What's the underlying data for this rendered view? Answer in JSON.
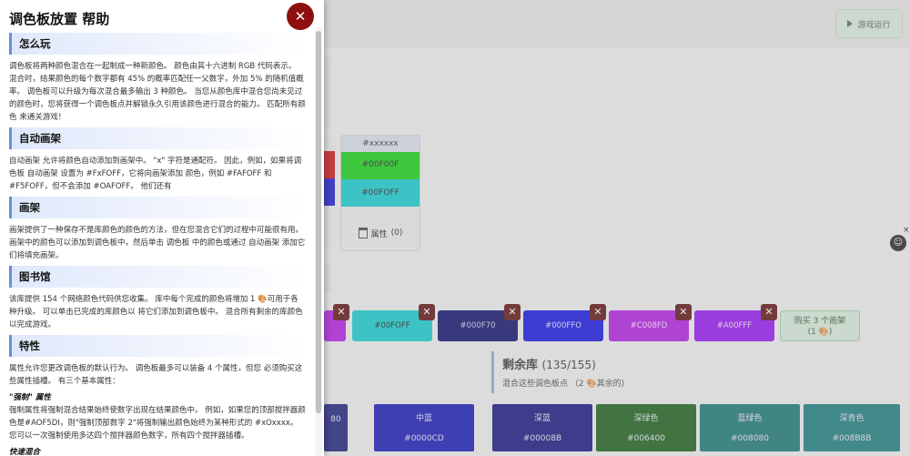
{
  "help": {
    "title": "调色板放置 帮助",
    "close_label": "✕",
    "sections": [
      {
        "heading": "怎么玩",
        "text": "调色板将两种颜色混合在一起制成一种新颜色。 颜色由其十六进制 RGB 代码表示。 混合时，结果颜色的每个数字都有 45% 的概率匹配任一父数字，外加 5% 的随机值概率。 调色板可以升级为每次混合最多输出 3 种颜色。 当您从颜色库中混合您尚未见过的颜色时，您将获得一个调色板点并解锁永久引用该颜色进行混合的能力。 匹配所有颜色 来通关游戏！"
      },
      {
        "heading": "自动画架",
        "text": "自动画架 允许将颜色自动添加到画架中。 \"x\" 字符是通配符。 因此，例如，如果将调色板 自动画架 设置为 #FxFOFF，它将向画架添加 颜色，例如 #FAFOFF 和 #F5FOFF，但不会添加 #OAFOFF。 他们还有"
      },
      {
        "heading": "画架",
        "text": "画架提供了一种保存不是库颜色的颜色的方法，但在您混合它们的过程中可能很有用。 画架中的颜色可以添加到调色板中，然后单击 调色板 中的颜色或通过 自动画架 添加它们将填充画架。"
      },
      {
        "heading": "图书馆",
        "text": "该库提供 154 个网络颜色代码供您收集。 库中每个完成的颜色将增加 1 🎨可用于各种升级。 可以单击已完成的库颜色以 将它们添加到调色板中。 混合所有剩余的库颜色以完成游戏。"
      },
      {
        "heading": "特性",
        "text": "属性允许您更改调色板的默认行为。 调色板最多可以装备 4 个属性，但您 必须购买这些属性插槽。 有三个基本属性："
      }
    ],
    "sub_heading": "\"强制\" 属性",
    "sub_text": "强制属性将强制混合结果始终使数字出现在结果颜色中。 例如，如果您的顶部搅拌器颜色是#AOF5DI，则\"强制顶部数字 2\"将强制输出颜色始终为某种形式的 #xOxxxx。 您可以一次强制使用多达四个搅拌器颜色数字，所有四个搅拌器插槽。",
    "next_heading": "快速混合"
  },
  "game": {
    "run_button": "游戏运行",
    "easel": {
      "code": "#xxxxxx",
      "color1": "#00F00F",
      "color2": "#00FOFF",
      "props_label": "属性",
      "props_count": "(0)"
    },
    "palette": [
      {
        "code": "#00FOFF",
        "bg": "#10c8cc",
        "fg": "#222222"
      },
      {
        "code": "#000F70",
        "bg": "#0a0a6a",
        "fg": "#c8c8e8"
      },
      {
        "code": "#000FFO",
        "bg": "#1010e0",
        "fg": "#d8d8f8"
      },
      {
        "code": "#C008FD",
        "bg": "#b018e0",
        "fg": "#f0d8f8"
      },
      {
        "code": "#A00FFF",
        "bg": "#9010f0",
        "fg": "#f0d8f8"
      }
    ],
    "buy_button": {
      "line1": "购买 3 个画架",
      "line2": "(1 🎨)"
    },
    "library": {
      "title": "剩余库",
      "count": "(135/155)",
      "subtitle": "混合这些调色板点 （2 🎨其余的)",
      "cards": [
        {
          "name": "",
          "code": "80",
          "bg": "#1a1a7a"
        },
        {
          "name": "中蓝",
          "code": "#0000CD",
          "bg": "#1212b4"
        },
        {
          "name": "深蓝",
          "code": "#00008B",
          "bg": "#10107c"
        },
        {
          "name": "深绿色",
          "code": "#006400",
          "bg": "#155c15"
        },
        {
          "name": "蓝绿色",
          "code": "#008080",
          "bg": "#167272"
        },
        {
          "name": "深青色",
          "code": "#008B8B",
          "bg": "#177979"
        }
      ]
    },
    "side_close": "×"
  }
}
